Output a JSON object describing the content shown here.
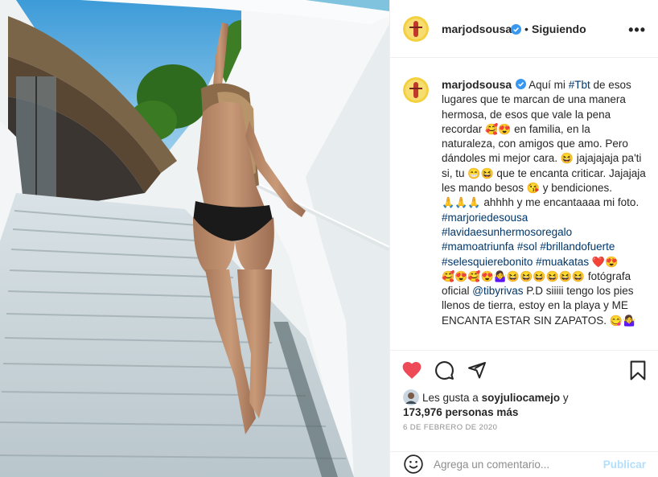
{
  "post": {
    "username": "marjodsousa",
    "separator": "•",
    "follow_label": "Siguiendo",
    "more_label": "•••"
  },
  "caption": {
    "username": "marjodsousa",
    "seg1": "Aquí mi ",
    "tag_tbt": "#Tbt",
    "seg2": " de esos lugares que te marcan de una manera hermosa, de esos que vale la pena recordar ",
    "emo1": "🥰😍",
    "seg3": " en familia, en la naturaleza, con amigos que amo. Pero dándoles mi mejor cara. ",
    "emo2": "😆",
    "seg4": " jajajajaja pa'ti si, tu ",
    "emo3": "😁😆",
    "seg5": " que te encanta criticar. Jajajaja les mando besos ",
    "emo4": "😘",
    "seg6": " y bendiciones. ",
    "emo5": "🙏🙏🙏",
    "seg7": " ahhhh y me encantaaaa mi foto. ",
    "tags": [
      "#marjoriedesousa",
      "#lavidaesunhermosoregalo",
      "#mamoatriunfa",
      "#sol",
      "#brillandofuerte",
      "#selesquierebonito",
      "#muakatas"
    ],
    "emo6": "❤️😍",
    "emo7": "🥰😍🥰😍🤷‍♀️😆😆😆😆😆😆",
    "seg8": " fotógrafa oficial ",
    "mention": "@tibyrivas",
    "seg9": " P.D siiiii tengo los pies llenos de tierra, estoy en la playa y ME ENCANTA ESTAR SIN ZAPATOS. ",
    "emo8": "😋🤷‍♀️"
  },
  "actions": {
    "like_icon": "heart-filled-icon",
    "comment_icon": "comment-icon",
    "share_icon": "share-icon",
    "save_icon": "bookmark-icon",
    "like_color": "#ed4956"
  },
  "likes": {
    "prefix": "Les gusta a ",
    "user": "soyjuliocamejo",
    "middle": " y",
    "count": "173,976 personas más"
  },
  "date": "6 DE FEBRERO DE 2020",
  "comment": {
    "placeholder": "Agrega un comentario...",
    "publish_label": "Publicar"
  },
  "colors": {
    "link_blue": "#00376b",
    "verified_blue": "#3897f0",
    "publish_disabled": "#b2dffc"
  }
}
